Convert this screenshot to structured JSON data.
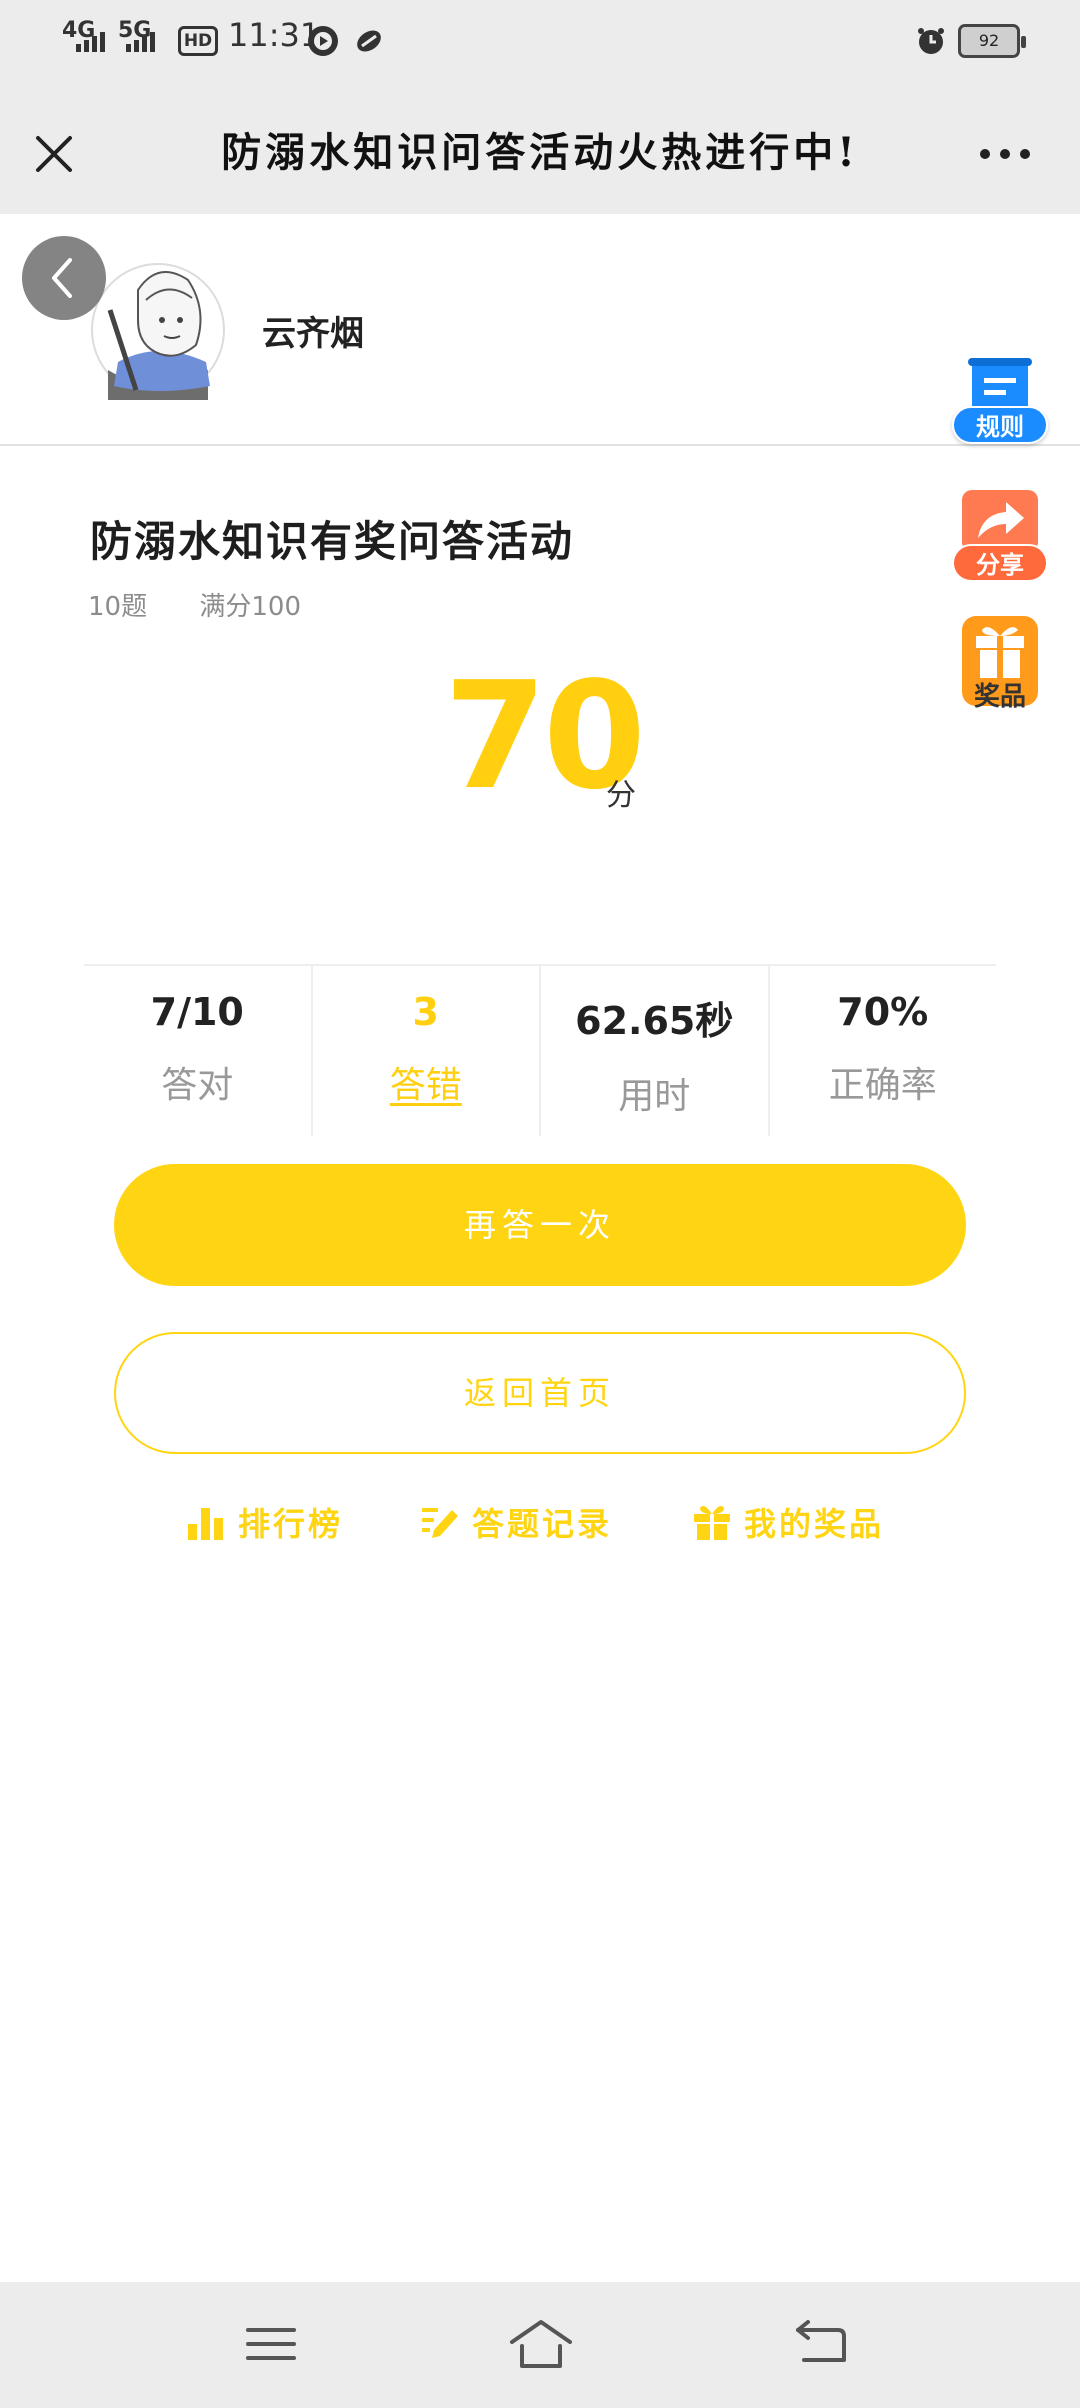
{
  "status_bar": {
    "network1": "4G",
    "network2": "5G",
    "hd": "HD",
    "hd_sub": "2",
    "time": "11:31",
    "battery": "92",
    "icons": [
      "signal-icon",
      "play-icon",
      "link-icon",
      "alarm-icon",
      "battery-icon"
    ]
  },
  "title_bar": {
    "title": "防溺水知识问答活动火热进行中!",
    "close_icon": "close-icon",
    "more_icon": "more-icon"
  },
  "user": {
    "name": "云齐烟"
  },
  "side_buttons": {
    "rules": "规则",
    "share": "分享",
    "prize": "奖品"
  },
  "quiz": {
    "title": "防溺水知识有奖问答活动",
    "question_count": "10题",
    "full_score": "满分100",
    "score": "70",
    "score_unit": "分"
  },
  "stats": [
    {
      "value": "7/10",
      "label": "答对"
    },
    {
      "value": "3",
      "label": "答错"
    },
    {
      "value": "62.65秒",
      "label": "用时"
    },
    {
      "value": "70%",
      "label": "正确率"
    }
  ],
  "buttons": {
    "retry": "再答一次",
    "home": "返回首页"
  },
  "links": {
    "ranking": "排行榜",
    "records": "答题记录",
    "my_prizes": "我的奖品"
  },
  "colors": {
    "accent": "#ffd513",
    "rules_blue": "#1a8cff",
    "share_orange": "#ff6a3d",
    "prize_orange": "#ff9a1a"
  }
}
